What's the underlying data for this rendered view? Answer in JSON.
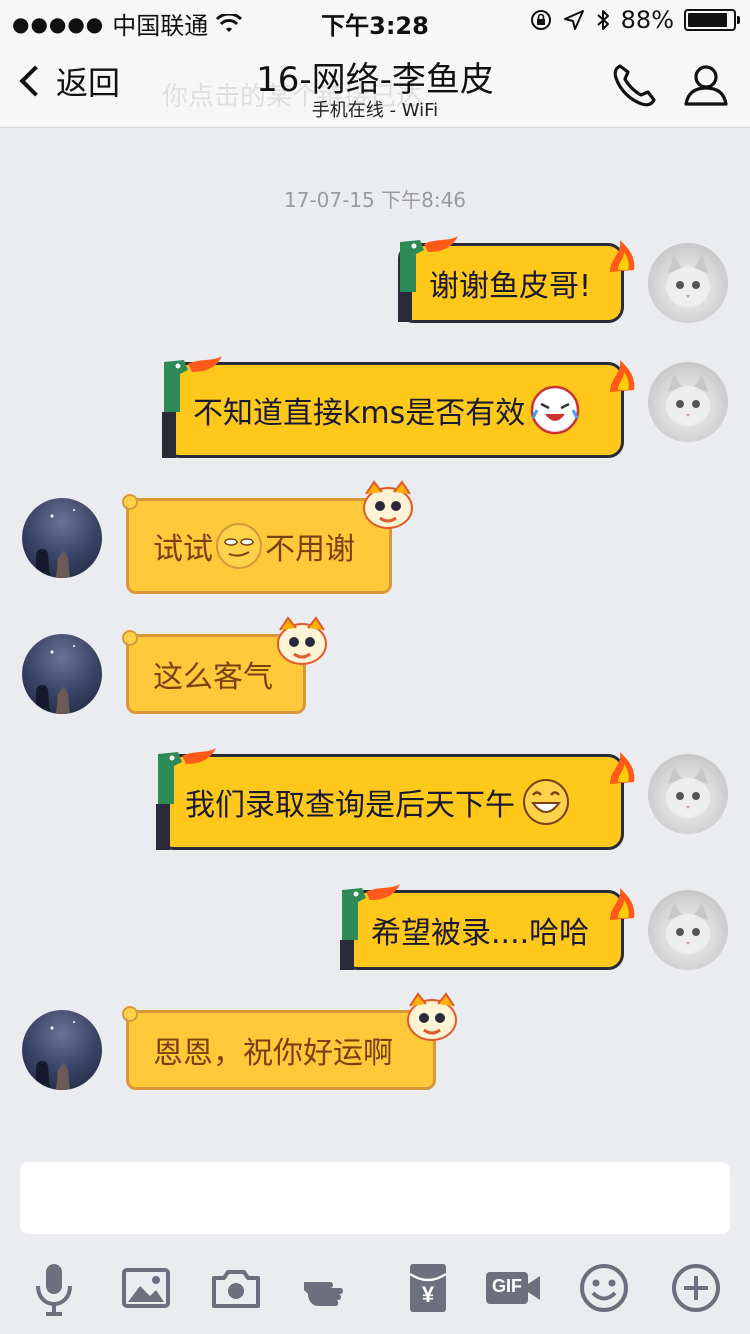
{
  "status": {
    "carrier": "中国联通",
    "time": "下午3:28",
    "battery": "88%",
    "battery_level": 0.88
  },
  "nav": {
    "back_label": "返回",
    "title": "16-网络-李鱼皮",
    "subtitle": "手机在线 - WiFi",
    "phantom_text": "你点击的某个链接已达"
  },
  "chat": {
    "timestamp": "17-07-15 下午8:46",
    "messages": [
      {
        "side": "out",
        "text": "谢谢鱼皮哥!"
      },
      {
        "side": "out",
        "text": "不知道直接kms是否有效"
      },
      {
        "side": "in",
        "text_a": "试试",
        "text_b": "不用谢"
      },
      {
        "side": "in",
        "text": "这么客气"
      },
      {
        "side": "out",
        "text": "我们录取查询是后天下午"
      },
      {
        "side": "out",
        "text": "希望被录....哈哈"
      },
      {
        "side": "in",
        "text": "恩恩，祝你好运啊"
      }
    ]
  },
  "input": {
    "value": "",
    "placeholder": ""
  },
  "toolbar": {
    "icons": [
      "microphone-icon",
      "image-icon",
      "camera-icon",
      "poke-icon",
      "red-packet-icon",
      "gif-icon",
      "emoji-icon",
      "plus-icon"
    ],
    "red_packet_symbol": "¥",
    "gif_label": "GIF"
  },
  "colors": {
    "outgoing_bubble": "#ffc81a",
    "incoming_bubble": "#ffc93a",
    "toolbar_icon": "#6c6f7d"
  }
}
